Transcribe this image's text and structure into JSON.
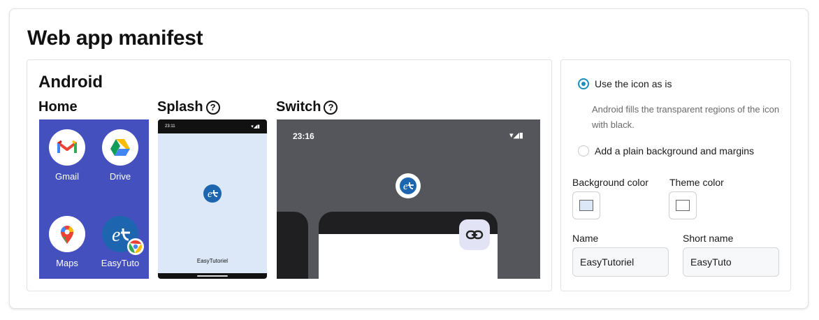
{
  "title": "Web app manifest",
  "android": {
    "title": "Android",
    "home": {
      "label": "Home",
      "apps": [
        {
          "name": "Gmail"
        },
        {
          "name": "Drive"
        },
        {
          "name": "Maps"
        },
        {
          "name": "EasyTuto"
        }
      ]
    },
    "splash": {
      "label": "Splash",
      "help_icon": "?",
      "status_time": "23:11",
      "status_icons": "▾◢▮",
      "app_name": "EasyTutoriel"
    },
    "switch": {
      "label": "Switch",
      "help_icon": "?",
      "status_time": "23:16",
      "status_icons": "▾◢▮"
    }
  },
  "options": {
    "as_is": {
      "label": "Use the icon as is",
      "selected": true
    },
    "hint": "Android fills the transparent regions of the icon with black.",
    "plain_bg": {
      "label": "Add a plain background and margins",
      "selected": false
    }
  },
  "colors": {
    "background_label": "Background color",
    "background_value": "#dce8f8",
    "theme_label": "Theme color",
    "theme_value": "#ffffff",
    "accent": "#1a8fb8",
    "home_bg": "#4450be",
    "switch_bg": "#55555c"
  },
  "name": {
    "label": "Name",
    "value": "EasyTutoriel"
  },
  "short_name": {
    "label": "Short name",
    "value": "EasyTuto"
  }
}
